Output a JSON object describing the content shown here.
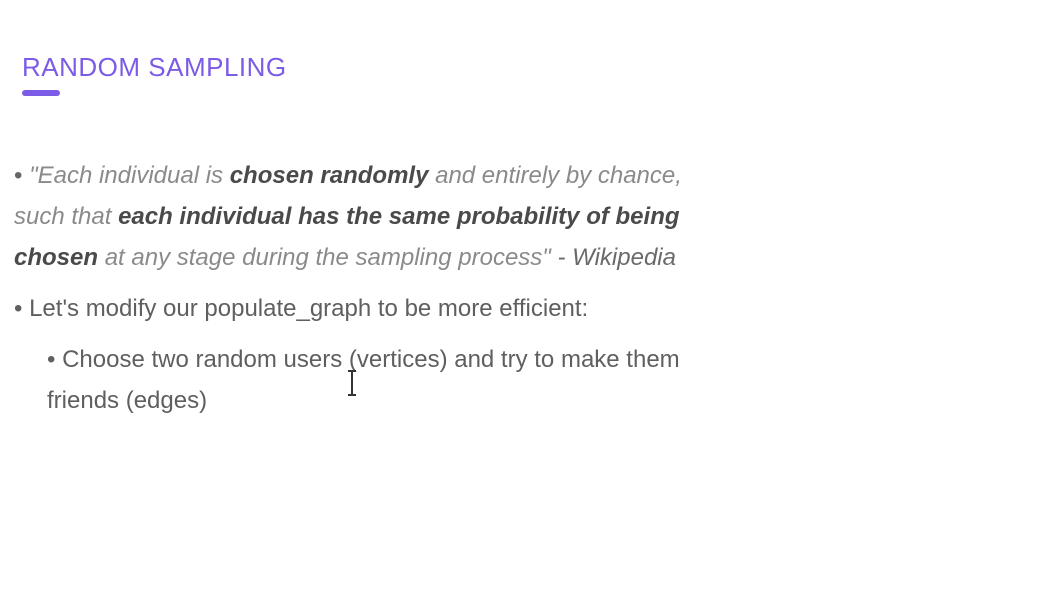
{
  "slide": {
    "title": "RANDOM SAMPLING",
    "accent_color": "#7c5ce6",
    "bullet_glyph": "•",
    "bullets": [
      {
        "segments": [
          "\"Each individual is ",
          "chosen randomly",
          " and entirely by chance, such that ",
          "each individual has the same probability of being chosen",
          " at any stage during the sampling process\"",
          " - Wikipedia"
        ]
      },
      {
        "text": "Let's modify our populate_graph to be more efficient:"
      },
      {
        "text": "Choose two random users (vertices) and try to make them friends (edges)"
      }
    ]
  },
  "cursor": {
    "icon": "text-cursor-icon"
  }
}
